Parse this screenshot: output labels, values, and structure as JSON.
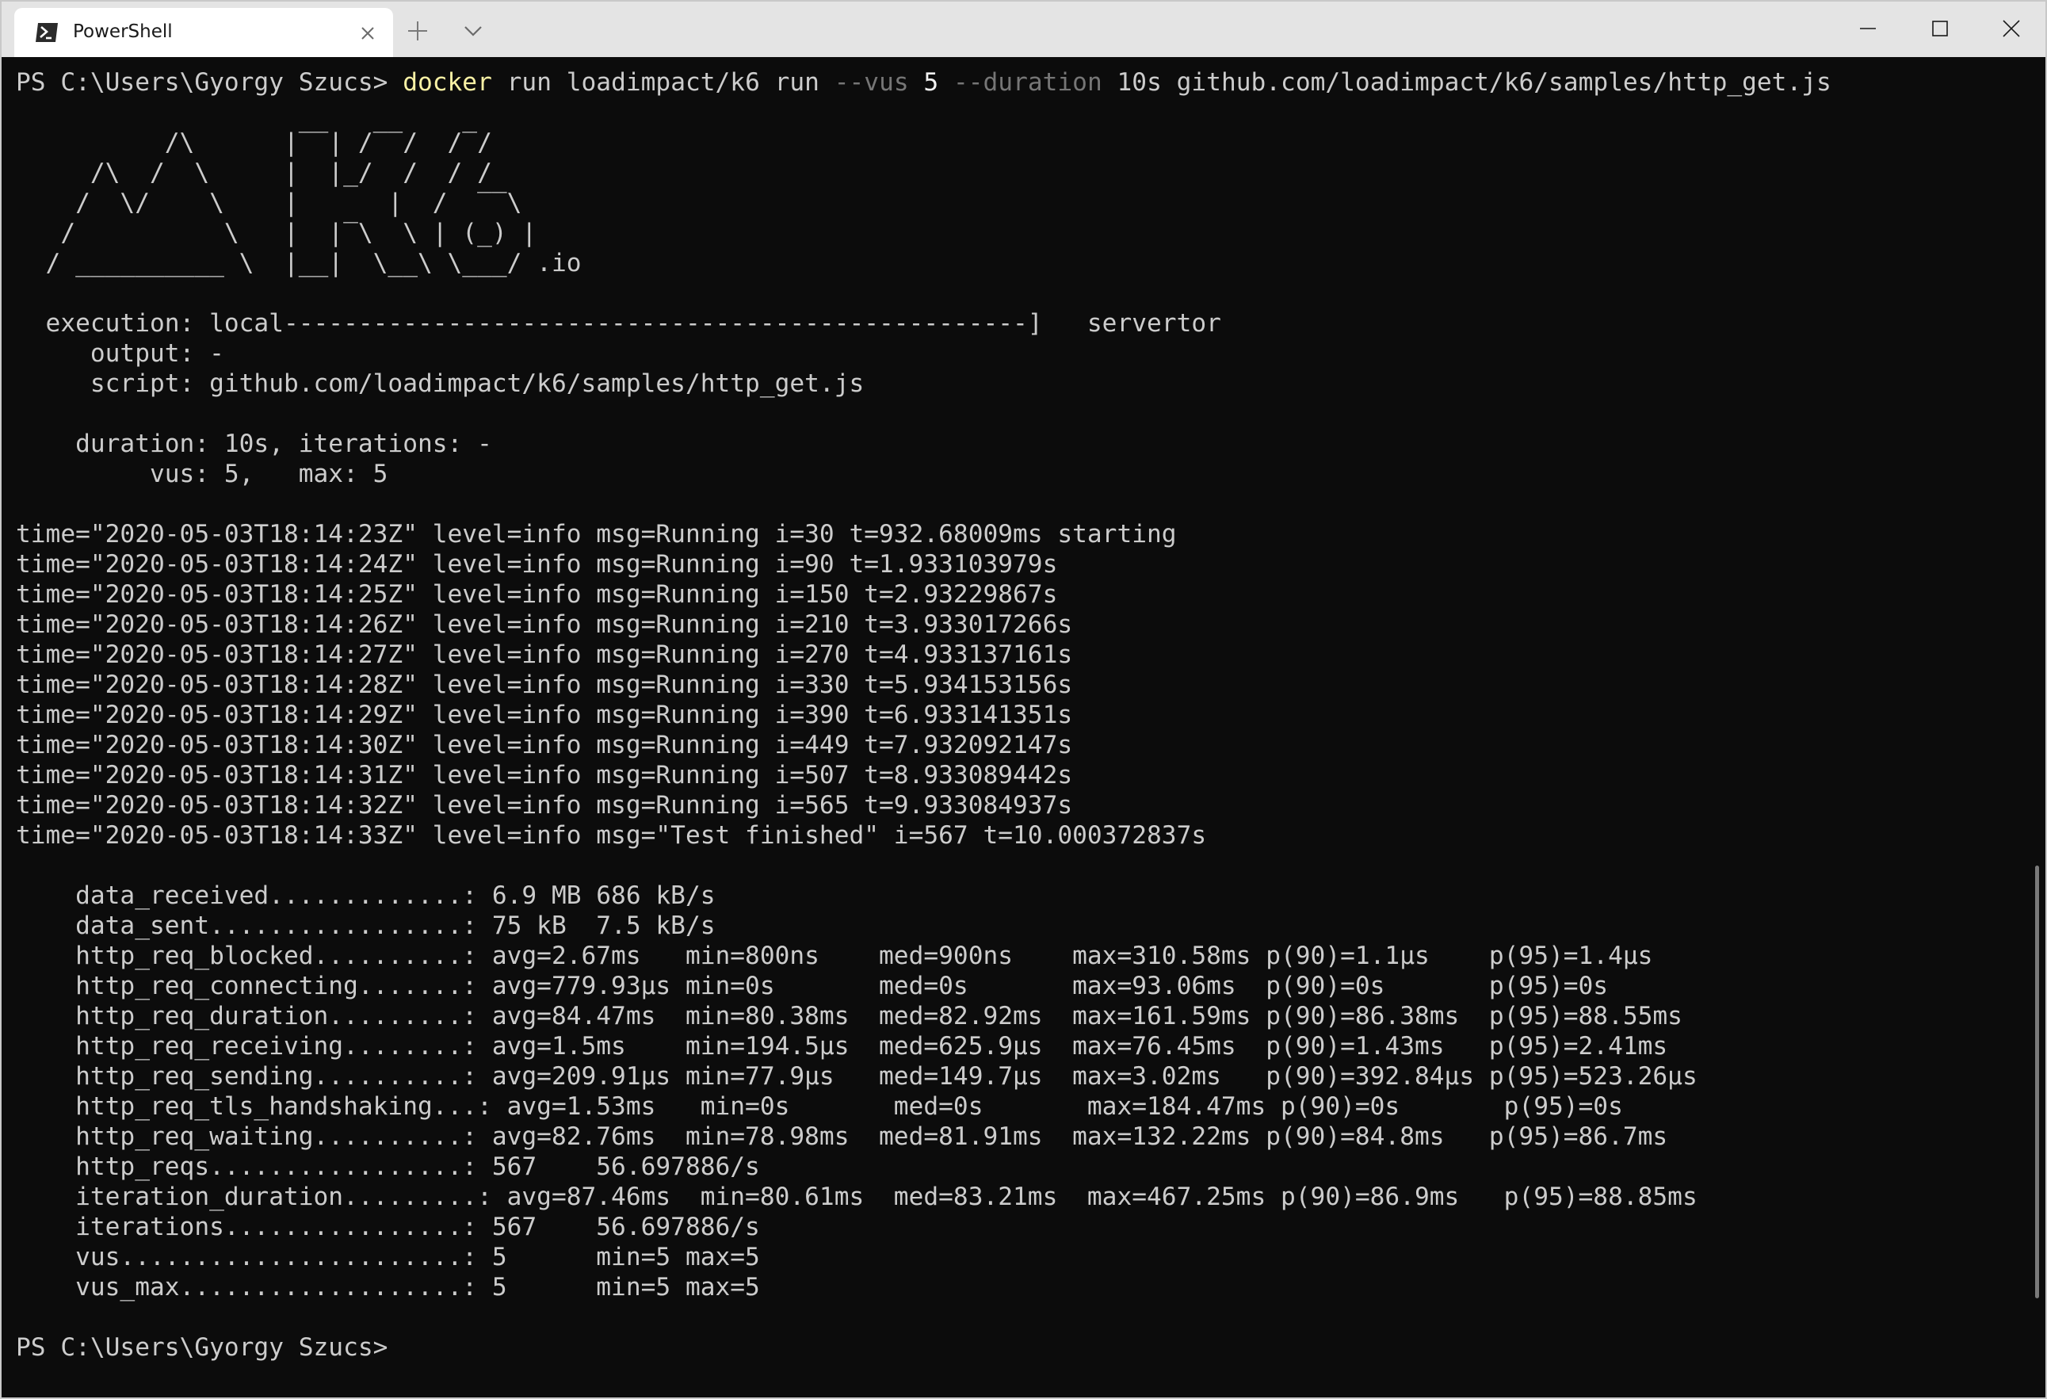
{
  "window": {
    "tab_title": "PowerShell"
  },
  "icons": {
    "tab": "powershell-icon",
    "close": "close-icon",
    "new_tab": "plus-icon",
    "dropdown": "chevron-down-icon",
    "minimize": "minimize-icon",
    "maximize": "maximize-icon",
    "window_close": "close-icon"
  },
  "colors": {
    "terminal_bg": "#0c0c0c",
    "text": "#cccccc",
    "command": "#f9f1a5",
    "parameter": "#767676",
    "titlebar": "#e4e4e4"
  },
  "terminal": {
    "prompt": "PS C:\\Users\\Gyorgy Szucs> ",
    "command": {
      "cmd": "docker",
      "args1": " run loadimpact/k6 run ",
      "flag_vus": "--vus",
      "vus_value": " 5 ",
      "flag_duration": "--duration",
      "rest": " 10s github.com/loadimpact/k6/samples/http_get.js"
    },
    "logo": [
      "          /\\      |‾‾| /‾‾/  /‾/",
      "     /\\  /  \\     |  |_/  /  / /",
      "    /  \\/    \\    |      |  /  ‾‾\\",
      "   /          \\   |  |‾\\  \\ | (_) |",
      "  / __________ \\  |__|  \\__\\ \\___/ .io"
    ],
    "header_lines": [
      "",
      "  execution: local--------------------------------------------------]   servertor",
      "     output: -",
      "     script: github.com/loadimpact/k6/samples/http_get.js",
      "",
      "    duration: 10s, iterations: -",
      "         vus: 5,   max: 5",
      ""
    ],
    "log_lines": [
      "time=\"2020-05-03T18:14:23Z\" level=info msg=Running i=30 t=932.68009ms starting",
      "time=\"2020-05-03T18:14:24Z\" level=info msg=Running i=90 t=1.933103979s",
      "time=\"2020-05-03T18:14:25Z\" level=info msg=Running i=150 t=2.93229867s",
      "time=\"2020-05-03T18:14:26Z\" level=info msg=Running i=210 t=3.933017266s",
      "time=\"2020-05-03T18:14:27Z\" level=info msg=Running i=270 t=4.933137161s",
      "time=\"2020-05-03T18:14:28Z\" level=info msg=Running i=330 t=5.934153156s",
      "time=\"2020-05-03T18:14:29Z\" level=info msg=Running i=390 t=6.933141351s",
      "time=\"2020-05-03T18:14:30Z\" level=info msg=Running i=449 t=7.932092147s",
      "time=\"2020-05-03T18:14:31Z\" level=info msg=Running i=507 t=8.933089442s",
      "time=\"2020-05-03T18:14:32Z\" level=info msg=Running i=565 t=9.933084937s",
      "time=\"2020-05-03T18:14:33Z\" level=info msg=\"Test finished\" i=567 t=10.000372837s",
      ""
    ],
    "metric_lines": [
      "    data_received.............: 6.9 MB 686 kB/s",
      "    data_sent.................: 75 kB  7.5 kB/s",
      "    http_req_blocked..........: avg=2.67ms   min=800ns    med=900ns    max=310.58ms p(90)=1.1µs    p(95)=1.4µs",
      "    http_req_connecting.......: avg=779.93µs min=0s       med=0s       max=93.06ms  p(90)=0s       p(95)=0s",
      "    http_req_duration.........: avg=84.47ms  min=80.38ms  med=82.92ms  max=161.59ms p(90)=86.38ms  p(95)=88.55ms",
      "    http_req_receiving........: avg=1.5ms    min=194.5µs  med=625.9µs  max=76.45ms  p(90)=1.43ms   p(95)=2.41ms",
      "    http_req_sending..........: avg=209.91µs min=77.9µs   med=149.7µs  max=3.02ms   p(90)=392.84µs p(95)=523.26µs",
      "    http_req_tls_handshaking...: avg=1.53ms   min=0s       med=0s       max=184.47ms p(90)=0s       p(95)=0s",
      "    http_req_waiting..........: avg=82.76ms  min=78.98ms  med=81.91ms  max=132.22ms p(90)=84.8ms   p(95)=86.7ms",
      "    http_reqs.................: 567    56.697886/s",
      "    iteration_duration.........: avg=87.46ms  min=80.61ms  med=83.21ms  max=467.25ms p(90)=86.9ms   p(95)=88.85ms",
      "    iterations................: 567    56.697886/s",
      "    vus.......................: 5      min=5 max=5",
      "    vus_max...................: 5      min=5 max=5",
      ""
    ],
    "final_prompt": "PS C:\\Users\\Gyorgy Szucs>"
  }
}
